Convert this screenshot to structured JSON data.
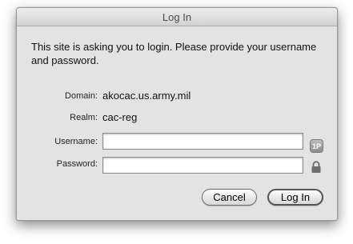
{
  "window": {
    "title": "Log In"
  },
  "message": "This site is asking you to login. Please provide your username and password.",
  "info": {
    "domain_label": "Domain:",
    "domain_value": "akocac.us.army.mil",
    "realm_label": "Realm:",
    "realm_value": "cac-reg"
  },
  "form": {
    "username_label": "Username:",
    "username_value": "",
    "password_label": "Password:",
    "password_value": "",
    "password_manager_icon": "1password-icon",
    "password_manager_text": "1P",
    "lock_icon": "lock-icon"
  },
  "buttons": {
    "cancel": "Cancel",
    "login": "Log In"
  }
}
